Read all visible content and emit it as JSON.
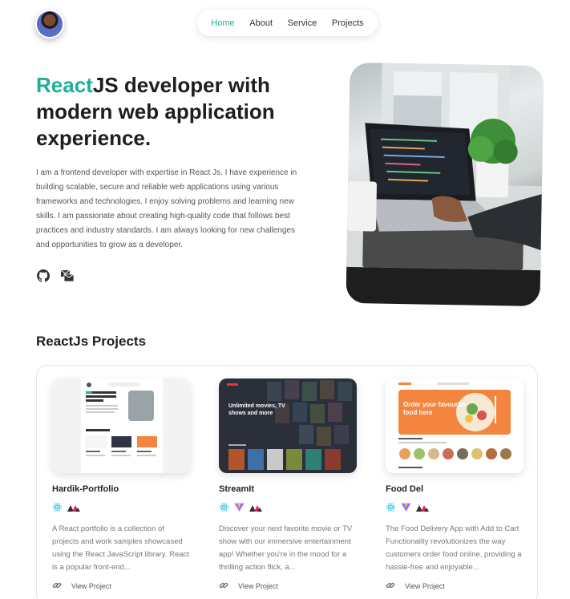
{
  "nav": {
    "items": [
      {
        "label": "Home",
        "active": true
      },
      {
        "label": "About",
        "active": false
      },
      {
        "label": "Service",
        "active": false
      },
      {
        "label": "Projects",
        "active": false
      }
    ]
  },
  "hero": {
    "title_accent": "React",
    "title_rest": "JS developer with modern web application experience.",
    "description": "I am a frontend developer with expertise in React Js. I have experience in building scalable, secure and reliable web applications using various frameworks and technologies. I enjoy solving problems and learning new skills. I am passionate about creating high-quality code that follows best practices and industry standards. I am always looking for new challenges and opportunities to grow as a developer.",
    "socials": [
      "github-icon",
      "email-icon"
    ]
  },
  "projects_section": {
    "title": "ReactJs Projects",
    "cards": [
      {
        "title": "Hardik-Portfolio",
        "tech": [
          "react-icon",
          "redux-icon"
        ],
        "description": "A React portfolio is a collection of projects and work samples showcased using the React JavaScript library. React is a popular front-end...",
        "link_label": "View Project"
      },
      {
        "title": "StreamIt",
        "tech": [
          "react-icon",
          "vite-icon",
          "redux-icon"
        ],
        "description": "Discover your next favorite movie or TV show with our immersive entertainment app! Whether you're in the mood for a thrilling action flick, a...",
        "link_label": "View Project"
      },
      {
        "title": "Food Del",
        "tech": [
          "react-icon",
          "vite-icon",
          "redux-icon"
        ],
        "description": "The Food Delivery App with Add to Cart Functionality revolutionizes the way customers order food online, providing a hassle-free and enjoyable...",
        "link_label": "View Project"
      }
    ]
  },
  "thumbs": {
    "streamit_heading": "Unlimited movies, TV shows and more",
    "food_heading": "Order your favourite food here"
  },
  "colors": {
    "accent": "#1fae97",
    "text_dark": "#1e1e1e",
    "food_orange": "#f3853f",
    "stream_dark": "#2a2f3a"
  }
}
